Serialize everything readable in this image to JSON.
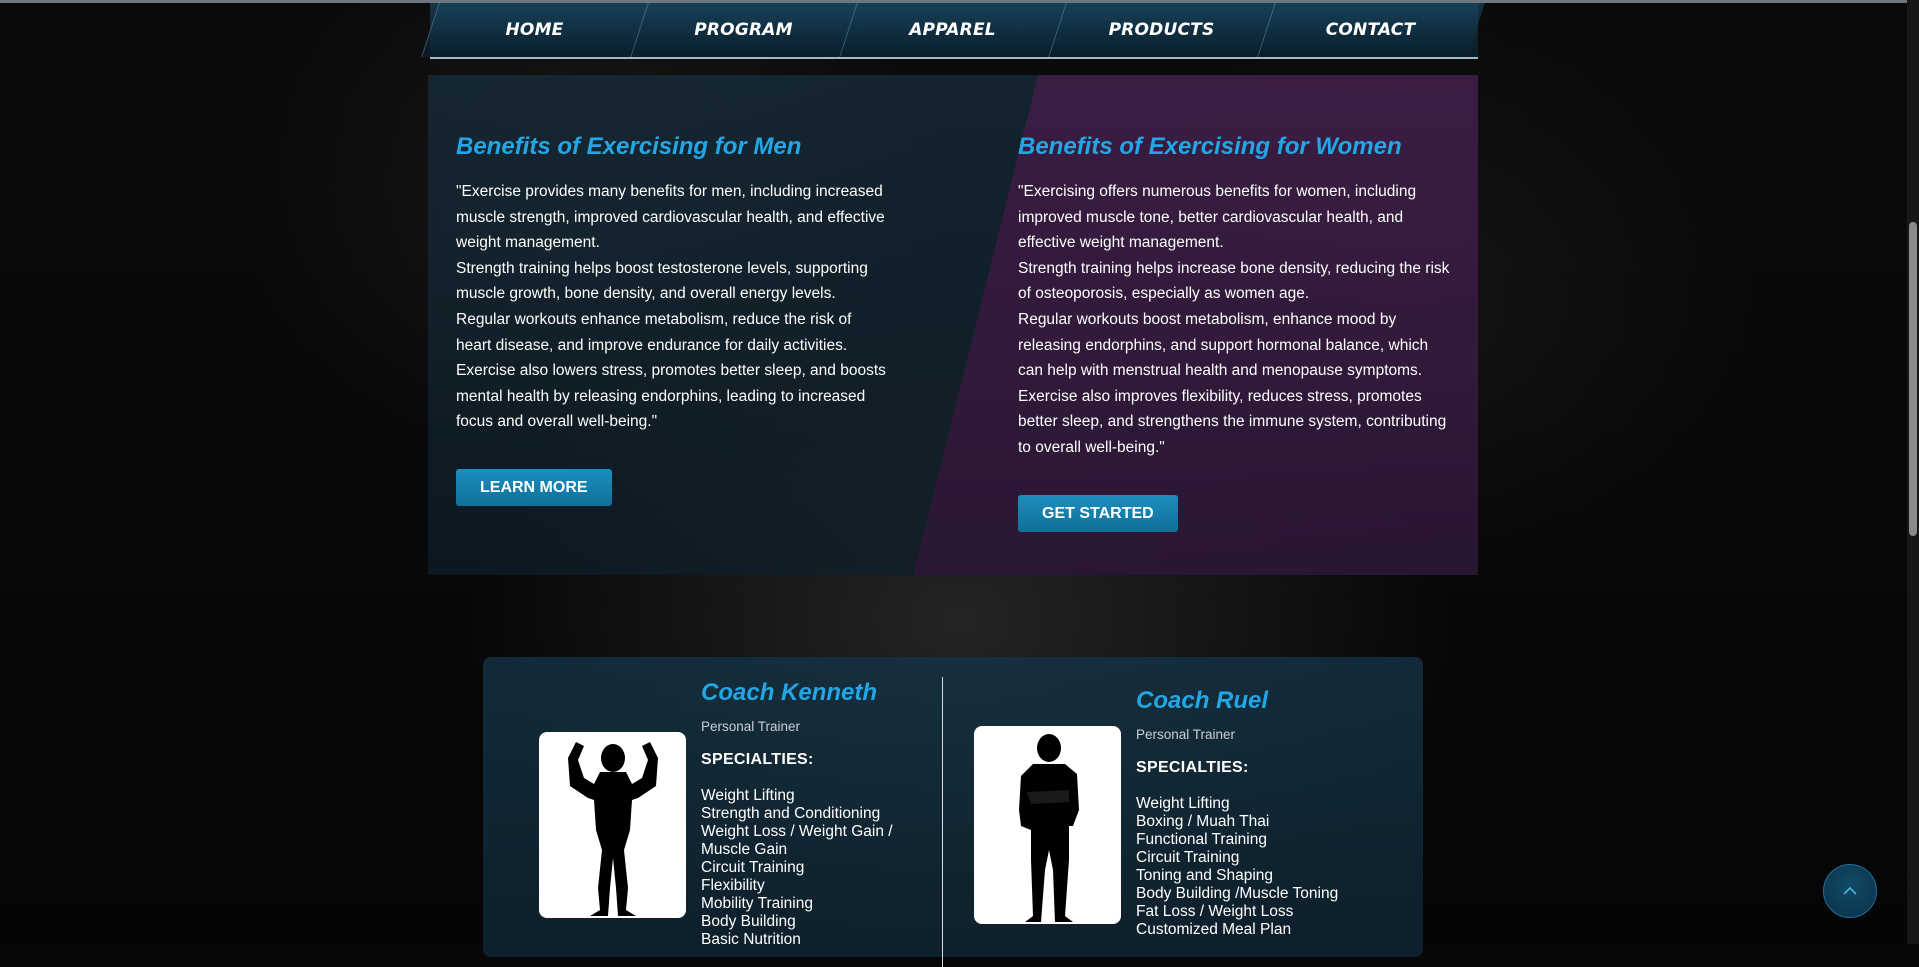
{
  "nav": {
    "items": [
      {
        "label": "HOME"
      },
      {
        "label": "PROGRAM"
      },
      {
        "label": "APPAREL"
      },
      {
        "label": "PRODUCTS"
      },
      {
        "label": "CONTACT"
      }
    ]
  },
  "benefits": {
    "men": {
      "title": "Benefits of Exercising for Men",
      "lines": [
        "\"Exercise provides many benefits for men, including increased muscle strength, improved cardiovascular health, and effective weight management.",
        "Strength training helps boost testosterone levels, supporting muscle growth, bone density, and overall energy levels.",
        "Regular workouts enhance metabolism, reduce the risk of heart disease, and improve endurance for daily activities.",
        "Exercise also lowers stress, promotes better sleep, and boosts mental health by releasing endorphins, leading to increased focus and overall well-being.\""
      ],
      "button": "LEARN MORE"
    },
    "women": {
      "title": "Benefits of Exercising for Women",
      "lines": [
        "\"Exercising offers numerous benefits for women, including improved muscle tone, better cardiovascular health, and effective weight management.",
        "Strength training helps increase bone density, reducing the risk of osteoporosis, especially as women age.",
        "Regular workouts boost metabolism, enhance mood by releasing endorphins, and support hormonal balance, which can help with menstrual health and menopause symptoms.",
        "Exercise also improves flexibility, reduces stress, promotes better sleep, and strengthens the immune system, contributing to overall well-being.\""
      ],
      "button": "GET STARTED"
    }
  },
  "coaches": [
    {
      "name": "Coach Kenneth",
      "role": "Personal Trainer",
      "specialties_label": "SPECIALTIES:",
      "specialties": [
        "Weight Lifting",
        "Strength and Conditioning",
        "Weight Loss / Weight Gain / Muscle Gain",
        "Circuit Training",
        "Flexibility",
        "Mobility Training",
        "Body Building",
        "Basic Nutrition"
      ]
    },
    {
      "name": "Coach Ruel",
      "role": "Personal Trainer",
      "specialties_label": "SPECIALTIES:",
      "specialties": [
        "Weight Lifting",
        "Boxing / Muah Thai",
        "Functional Training",
        "Circuit Training",
        "Toning and Shaping",
        "Body Building /Muscle Toning",
        "Fat Loss / Weight Loss",
        "Customized Meal Plan"
      ]
    }
  ],
  "icons": {
    "back_to_top": "chevron-up-icon"
  },
  "colors": {
    "accent": "#22a6e6",
    "button": "#1586b4",
    "women_panel": "#3f1d45"
  }
}
